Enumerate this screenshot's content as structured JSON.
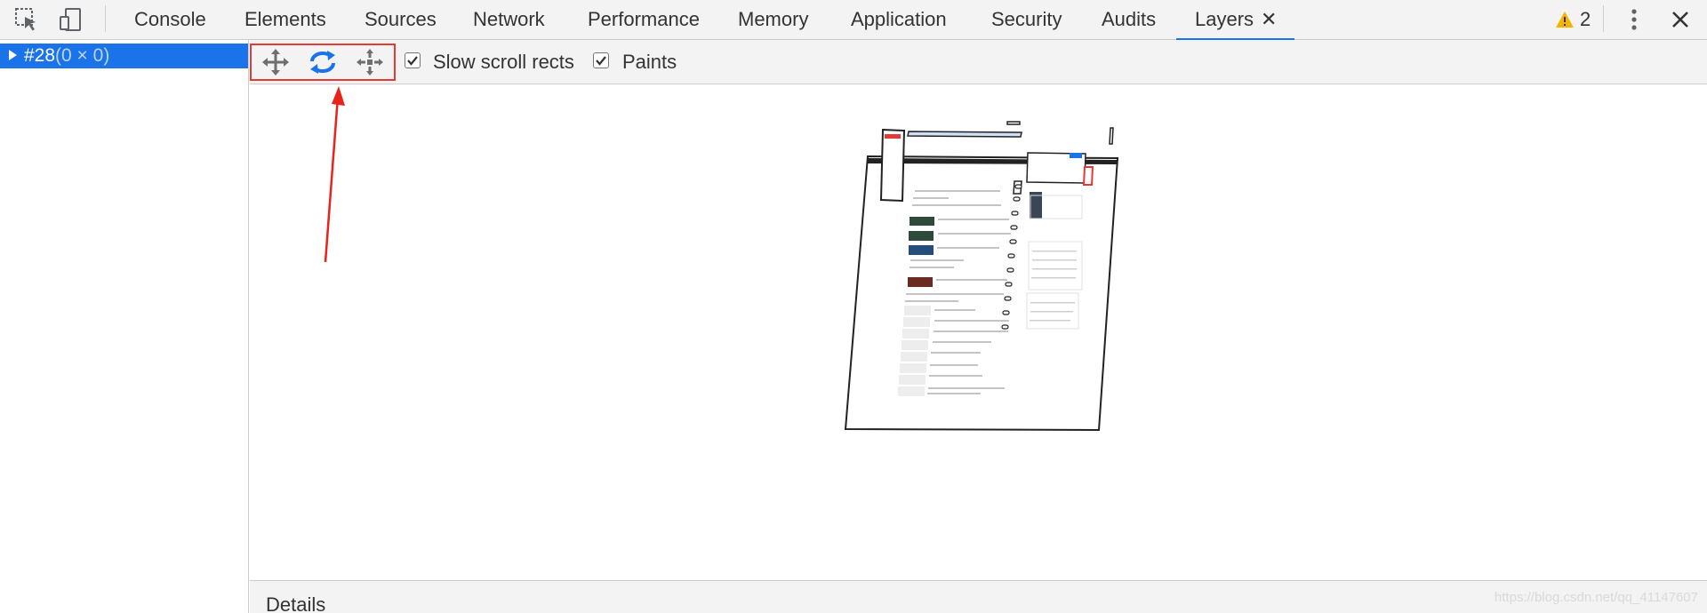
{
  "toolbar": {
    "tabs": [
      "Console",
      "Elements",
      "Sources",
      "Network",
      "Performance",
      "Memory",
      "Application",
      "Security",
      "Audits",
      "Layers"
    ],
    "active_tab": "Layers",
    "warning_count": "2",
    "accent_color": "#1a73e8",
    "warning_color": "#f4b400"
  },
  "tree": {
    "selected_id": "#28",
    "selected_size": "(0 × 0)"
  },
  "layers_toolbar": {
    "modes": [
      "pan-mode-icon",
      "rotate-mode-icon",
      "reset-transform-icon"
    ],
    "slow_scroll_label": "Slow scroll rects",
    "slow_scroll_checked": true,
    "paints_label": "Paints",
    "paints_checked": true,
    "highlight_color": "#e53935"
  },
  "details": {
    "title": "Details"
  },
  "watermark": "https://blog.csdn.net/qq_41147607"
}
